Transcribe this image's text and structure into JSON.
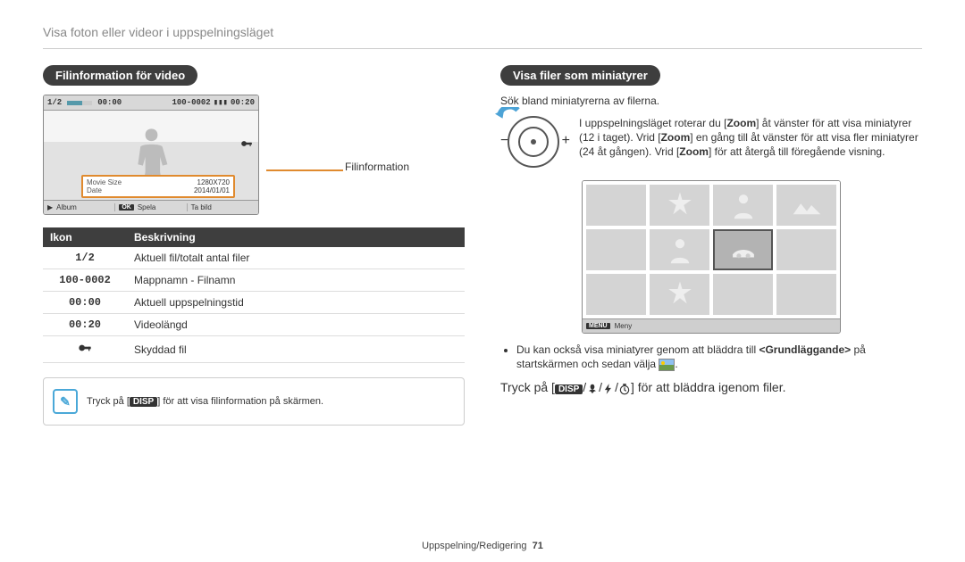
{
  "breadcrumb": "Visa foton eller videor i uppspelningsläget",
  "left": {
    "heading": "Filinformation för video",
    "callout": "Filinformation",
    "preview": {
      "counter": "1/2",
      "playtime": "00:00",
      "folder_file": "100-0002",
      "length": "00:20",
      "info": {
        "size_key": "Movie Size",
        "size_val": "1280X720",
        "date_key": "Date",
        "date_val": "2014/01/01"
      },
      "footbar": {
        "album_icon": "▶",
        "album": "Album",
        "ok": "OK",
        "play": "Spela",
        "tobild": "Ta bild"
      }
    },
    "table": {
      "headers": {
        "icon": "Ikon",
        "desc": "Beskrivning"
      },
      "rows": [
        {
          "icon": "1/2",
          "desc": "Aktuell fil/totalt antal filer"
        },
        {
          "icon": "100-0002",
          "desc": "Mappnamn - Filnamn"
        },
        {
          "icon": "00:00",
          "desc": "Aktuell uppspelningstid"
        },
        {
          "icon": "00:20",
          "desc": "Videolängd"
        },
        {
          "icon": "🔑",
          "desc": "Skyddad fil",
          "is_key": true
        }
      ]
    },
    "note": {
      "pre": "Tryck på [",
      "key": "DISP",
      "post": "] för att visa filinformation på skärmen."
    }
  },
  "right": {
    "heading": "Visa filer som miniatyrer",
    "intro": "Sök bland miniatyrerna av filerna.",
    "tip": {
      "pre1": "I uppspelningsläget roterar du [",
      "z1": "Zoom",
      "mid1": "] åt vänster för att visa miniatyrer (12 i taget). Vrid [",
      "z2": "Zoom",
      "mid2": "] en gång till åt vänster för att visa fler miniatyrer (24 åt gången). Vrid [",
      "z3": "Zoom",
      "post": "] för att återgå till föregående visning."
    },
    "thumb_bar": {
      "menu": "MENU",
      "label": "Meny"
    },
    "bullet": {
      "pre": "Du kan också visa miniatyrer genom att bläddra till ",
      "strong": "<Grundläggande>",
      "mid": " på startskärmen och sedan välja ",
      "post": "."
    },
    "bigline": {
      "pre": "Tryck på [",
      "disp": "DISP",
      "post": "] för att bläddra igenom filer."
    }
  },
  "footer": {
    "section": "Uppspelning/Redigering",
    "page": "71"
  }
}
